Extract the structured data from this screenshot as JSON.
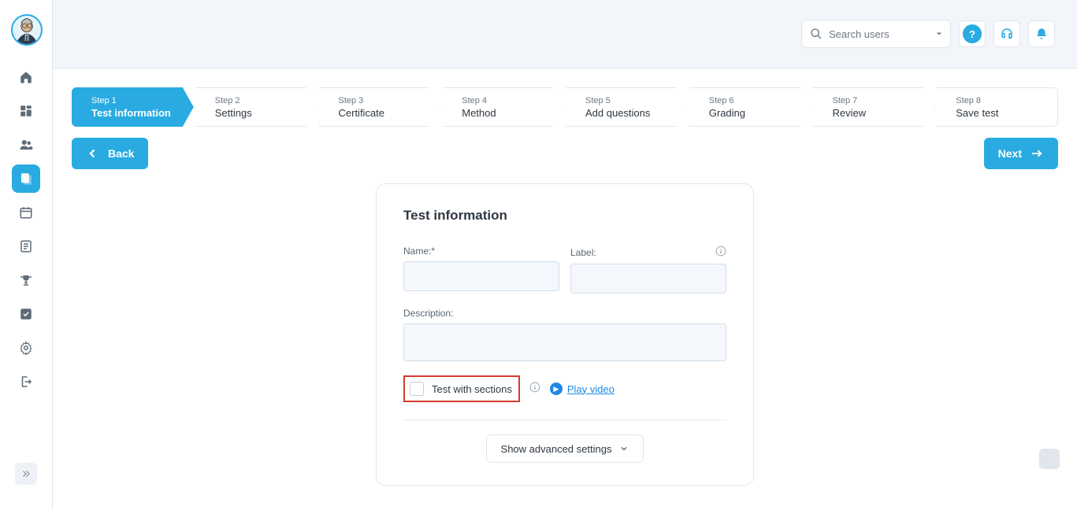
{
  "search": {
    "placeholder": "Search users"
  },
  "nav": [
    {
      "name": "home-icon"
    },
    {
      "name": "dashboard-icon"
    },
    {
      "name": "users-icon"
    },
    {
      "name": "tests-icon",
      "active": true
    },
    {
      "name": "calendar-icon"
    },
    {
      "name": "surveys-icon"
    },
    {
      "name": "trophy-icon"
    },
    {
      "name": "check-icon"
    },
    {
      "name": "gear-icon"
    },
    {
      "name": "logout-icon"
    }
  ],
  "steps": [
    {
      "num": "Step 1",
      "title": "Test information",
      "active": true
    },
    {
      "num": "Step 2",
      "title": "Settings"
    },
    {
      "num": "Step 3",
      "title": "Certificate"
    },
    {
      "num": "Step 4",
      "title": "Method"
    },
    {
      "num": "Step 5",
      "title": "Add questions"
    },
    {
      "num": "Step 6",
      "title": "Grading"
    },
    {
      "num": "Step 7",
      "title": "Review"
    },
    {
      "num": "Step 8",
      "title": "Save test"
    }
  ],
  "buttons": {
    "back": "Back",
    "next": "Next",
    "advanced": "Show advanced settings"
  },
  "card": {
    "title": "Test information",
    "name_label": "Name:*",
    "label_label": "Label:",
    "desc_label": "Description:",
    "name_value": "",
    "label_value": "",
    "desc_value": "",
    "sections_label": "Test with sections",
    "play_video": "Play video"
  }
}
